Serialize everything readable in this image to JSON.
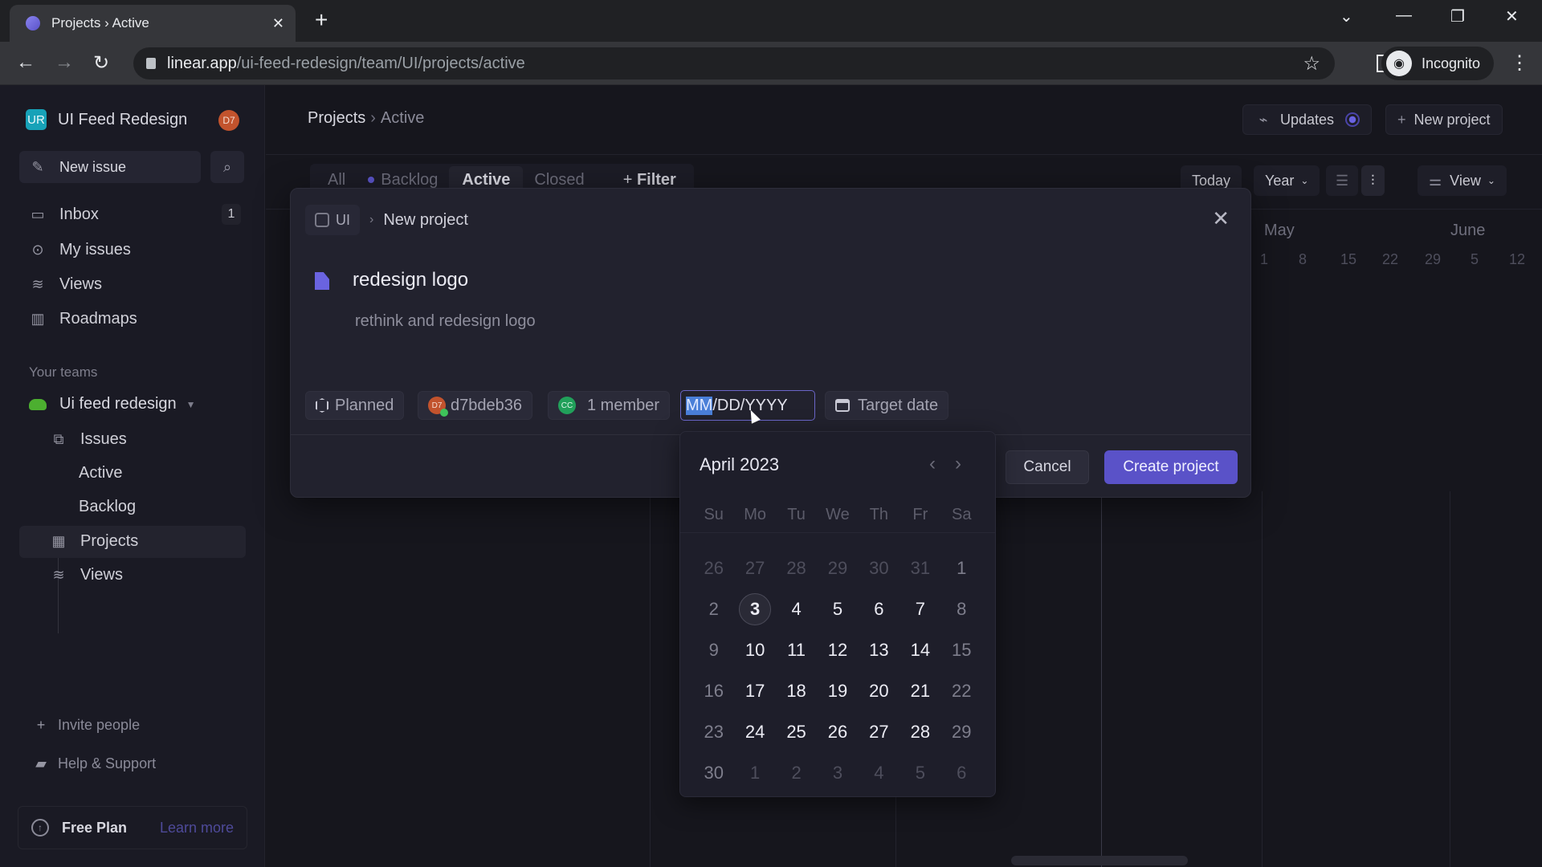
{
  "browser": {
    "tab_title": "Projects › Active",
    "url_host": "linear.app",
    "url_path": "/ui-feed-redesign/team/UI/projects/active",
    "profile_label": "Incognito",
    "icons": {
      "back": "←",
      "forward": "→",
      "reload": "↻",
      "star": "☆",
      "kebab": "⋮",
      "new_tab": "+",
      "close_tab": "✕",
      "tab_search": "⌄",
      "minimize": "—",
      "restore": "❐",
      "close_window": "✕",
      "incognito": "👓"
    }
  },
  "sidebar": {
    "workspace_badge": "UR",
    "workspace_name": "UI Feed Redesign",
    "user_initials": "D7",
    "new_issue_label": "New issue",
    "nav": [
      {
        "label": "Inbox",
        "icon": "inbox-icon",
        "count": "1"
      },
      {
        "label": "My issues",
        "icon": "my-issues-icon"
      },
      {
        "label": "Views",
        "icon": "layers-icon"
      },
      {
        "label": "Roadmaps",
        "icon": "map-icon"
      }
    ],
    "teams_heading": "Your teams",
    "team_name": "Ui feed redesign",
    "team_items": [
      {
        "label": "Issues"
      },
      {
        "label": "Active"
      },
      {
        "label": "Backlog"
      },
      {
        "label": "Projects",
        "active": true
      },
      {
        "label": "Views"
      }
    ],
    "invite_label": "Invite people",
    "help_label": "Help & Support",
    "plan_label": "Free Plan",
    "learn_more_label": "Learn more"
  },
  "main": {
    "breadcrumb_root": "Projects",
    "breadcrumb_current": "Active",
    "updates_label": "Updates",
    "new_project_label": "New project",
    "filter_tabs": [
      "All",
      "Backlog",
      "Active",
      "Closed"
    ],
    "active_filter_tab": "Active",
    "filter_label": "Filter",
    "today_label": "Today",
    "zoom_label": "Year",
    "view_label": "View",
    "timeline_months": [
      "May",
      "June"
    ],
    "timeline_weeks": [
      "1",
      "8",
      "15",
      "22",
      "29",
      "5",
      "12"
    ]
  },
  "modal": {
    "team_chip": "UI",
    "title": "New project",
    "project_name": "redesign logo",
    "project_description": "rethink and redesign logo",
    "status_label": "Planned",
    "lead_initials": "D7",
    "lead_label": "d7bdeb36",
    "member_initials": "CC",
    "members_label": "1 member",
    "start_date_selected": "MM",
    "start_date_rest": "/DD/YYYY",
    "target_date_label": "Target date",
    "cancel_label": "Cancel",
    "create_label": "Create project"
  },
  "calendar": {
    "month_label": "April 2023",
    "weekdays": [
      "Su",
      "Mo",
      "Tu",
      "We",
      "Th",
      "Fr",
      "Sa"
    ],
    "today": "3",
    "days": [
      {
        "d": "26",
        "out": true
      },
      {
        "d": "27",
        "out": true
      },
      {
        "d": "28",
        "out": true
      },
      {
        "d": "29",
        "out": true
      },
      {
        "d": "30",
        "out": true
      },
      {
        "d": "31",
        "out": true
      },
      {
        "d": "1",
        "wkend": true
      },
      {
        "d": "2",
        "wkend": true
      },
      {
        "d": "3",
        "today": true
      },
      {
        "d": "4"
      },
      {
        "d": "5"
      },
      {
        "d": "6"
      },
      {
        "d": "7"
      },
      {
        "d": "8",
        "wkend": true
      },
      {
        "d": "9",
        "wkend": true
      },
      {
        "d": "10"
      },
      {
        "d": "11"
      },
      {
        "d": "12"
      },
      {
        "d": "13"
      },
      {
        "d": "14"
      },
      {
        "d": "15",
        "wkend": true
      },
      {
        "d": "16",
        "wkend": true
      },
      {
        "d": "17"
      },
      {
        "d": "18"
      },
      {
        "d": "19"
      },
      {
        "d": "20"
      },
      {
        "d": "21"
      },
      {
        "d": "22",
        "wkend": true
      },
      {
        "d": "23",
        "wkend": true
      },
      {
        "d": "24"
      },
      {
        "d": "25"
      },
      {
        "d": "26"
      },
      {
        "d": "27"
      },
      {
        "d": "28"
      },
      {
        "d": "29",
        "wkend": true
      },
      {
        "d": "30",
        "wkend": true
      },
      {
        "d": "1",
        "out": true
      },
      {
        "d": "2",
        "out": true
      },
      {
        "d": "3",
        "out": true
      },
      {
        "d": "4",
        "out": true
      },
      {
        "d": "5",
        "out": true
      },
      {
        "d": "6",
        "out": true
      }
    ]
  },
  "colors": {
    "accent": "#5a52c8",
    "team_green": "#4caf30",
    "workspace_teal": "#17a2b8",
    "avatar_orange": "#c2532d"
  }
}
